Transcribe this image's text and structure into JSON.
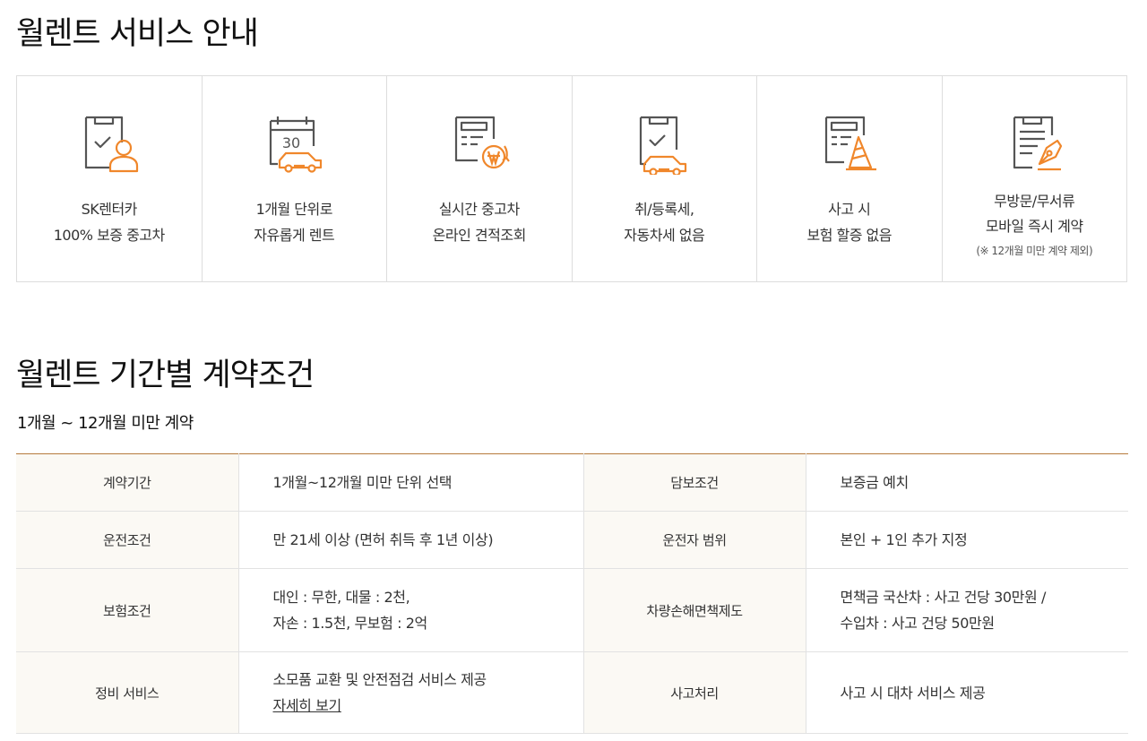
{
  "section1": {
    "title": "월렌트 서비스 안내",
    "features": [
      {
        "icon": "clipboard-person-icon",
        "lines": [
          "SK렌터카",
          "100% 보증 중고차"
        ]
      },
      {
        "icon": "calendar-car-icon",
        "calendar_day": "30",
        "lines": [
          "1개월 단위로",
          "자유롭게 렌트"
        ]
      },
      {
        "icon": "document-won-refresh-icon",
        "lines": [
          "실시간 중고차",
          "온라인 견적조회"
        ]
      },
      {
        "icon": "clipboard-check-car-icon",
        "lines": [
          "취/등록세,",
          "자동차세 없음"
        ]
      },
      {
        "icon": "document-cone-icon",
        "lines": [
          "사고 시",
          "보험 할증 없음"
        ]
      },
      {
        "icon": "document-pen-icon",
        "lines": [
          "무방문/무서류",
          "모바일 즉시 계약"
        ],
        "note": "(※ 12개월 미만 계약 제외)"
      }
    ]
  },
  "section2": {
    "title": "월렌트 기간별 계약조건",
    "subtitle": "1개월 ~ 12개월 미만 계약",
    "rows": [
      {
        "label1": "계약기간",
        "value1": [
          "1개월~12개월 미만 단위 선택"
        ],
        "label2": "담보조건",
        "value2": [
          "보증금 예치"
        ]
      },
      {
        "label1": "운전조건",
        "value1": [
          "만 21세 이상 (면허 취득 후 1년 이상)"
        ],
        "label2": "운전자 범위",
        "value2": [
          "본인 + 1인 추가 지정"
        ]
      },
      {
        "label1": "보험조건",
        "value1": [
          "대인 : 무한, 대물 : 2천,",
          "자손 : 1.5천, 무보험 : 2억"
        ],
        "label2": "차량손해면책제도",
        "value2": [
          "면책금 국산차 : 사고 건당 30만원 /",
          "수입차 : 사고 건당 50만원"
        ]
      },
      {
        "label1": "정비 서비스",
        "value1": [
          "소모품 교환 및 안전점검 서비스 제공"
        ],
        "link": "자세히 보기",
        "label2": "사고처리",
        "value2": [
          "사고 시 대차 서비스 제공"
        ]
      }
    ]
  },
  "colors": {
    "accent": "#f0872b",
    "icon_line": "#555555",
    "table_top_border": "#b67a3c",
    "header_bg": "#fbf9f4"
  }
}
